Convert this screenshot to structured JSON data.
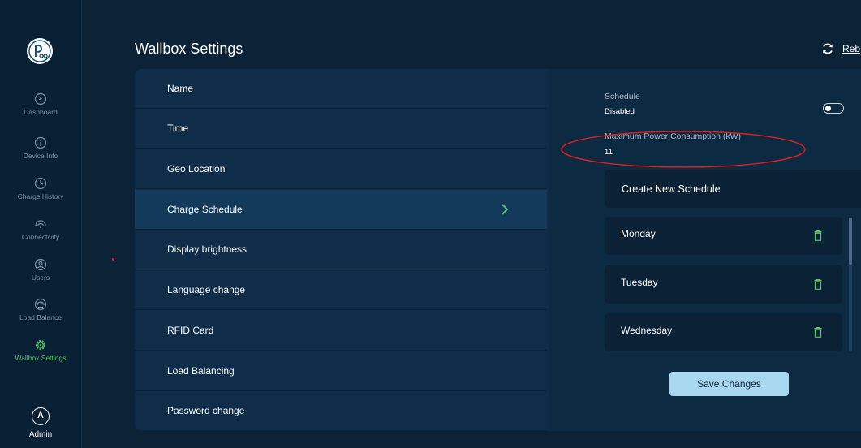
{
  "app": {
    "title": "Wallbox Settings",
    "reboot_label": "Reb"
  },
  "sidebar": {
    "items": [
      {
        "label": "Dashboard",
        "icon": "dashboard-icon"
      },
      {
        "label": "Device Info",
        "icon": "info-icon"
      },
      {
        "label": "Charge History",
        "icon": "clock-icon"
      },
      {
        "label": "Connectivity",
        "icon": "wifi-icon"
      },
      {
        "label": "Users",
        "icon": "user-icon"
      },
      {
        "label": "Load Balance",
        "icon": "gauge-icon"
      },
      {
        "label": "Wallbox Settings",
        "icon": "gear-icon",
        "active": true
      }
    ],
    "user": {
      "initial": "A",
      "label": "Admin"
    }
  },
  "menu": {
    "items": [
      "Name",
      "Time",
      "Geo Location",
      "Charge Schedule",
      "Display brightness",
      "Language change",
      "RFID Card",
      "Load Balancing",
      "Password change"
    ],
    "active_index": 3
  },
  "schedule": {
    "label": "Schedule",
    "status": "Disabled",
    "enabled": false,
    "max_power_label": "Maximum Power Consumption (kW)",
    "max_power_value": "11",
    "create_label": "Create New Schedule",
    "days": [
      "Monday",
      "Tuesday",
      "Wednesday"
    ],
    "save_label": "Save Changes"
  },
  "colors": {
    "accent": "#58c46a",
    "background": "#0b2237",
    "panel": "#0f2d48",
    "highlight": "#133a5b",
    "annotation": "#d9201e"
  }
}
